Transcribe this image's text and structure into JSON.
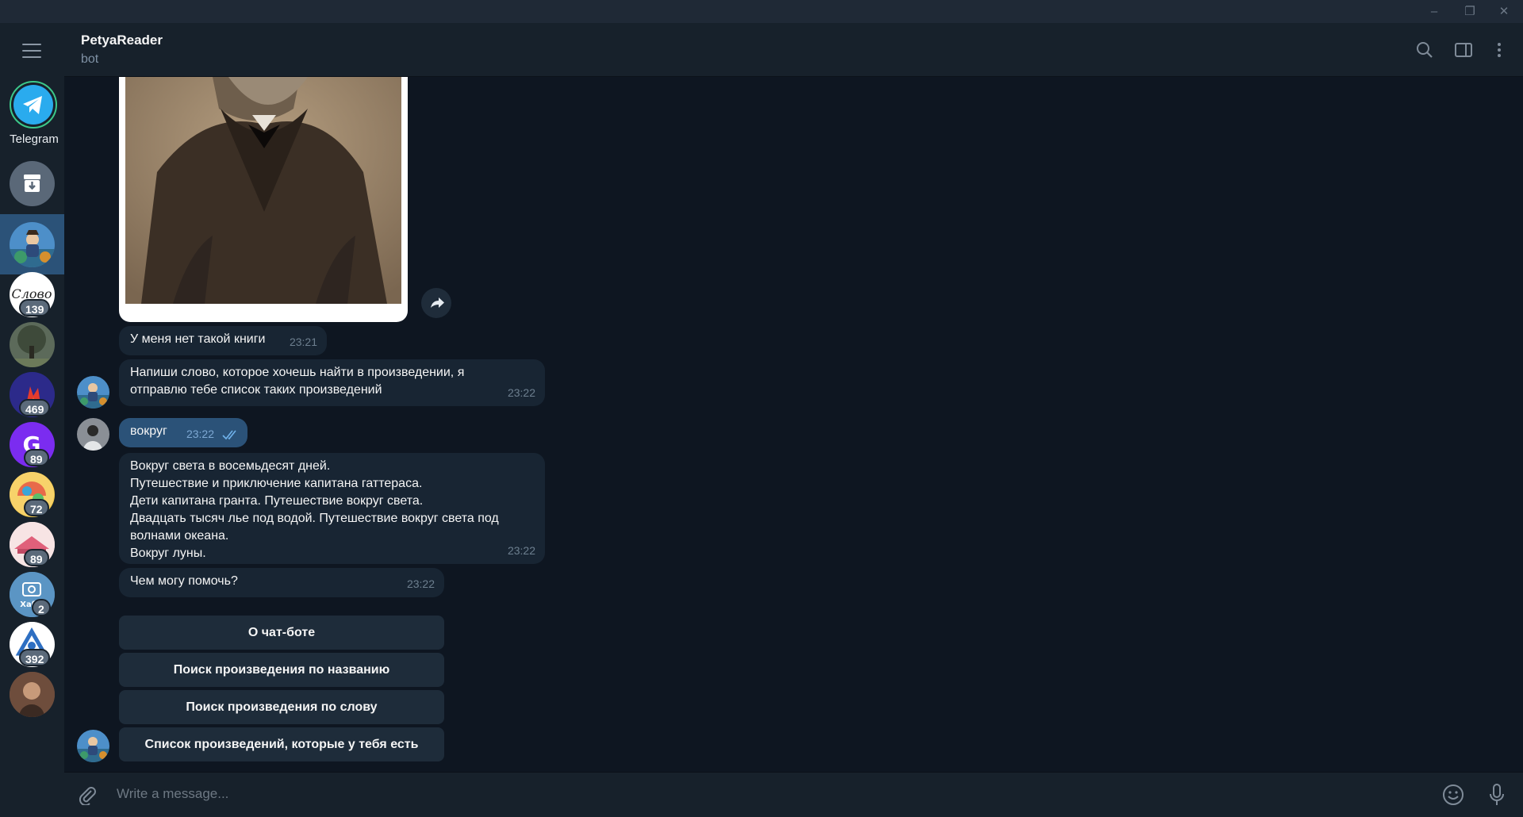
{
  "window": {
    "minimize_glyph": "–",
    "restore_glyph": "❐",
    "close_glyph": "✕"
  },
  "sidebar": {
    "folder_label": "Telegram",
    "chats": [
      {
        "badge": ""
      },
      {
        "badge": "139"
      },
      {
        "badge": ""
      },
      {
        "badge": "469"
      },
      {
        "badge": "89"
      },
      {
        "badge": "72"
      },
      {
        "badge": "89"
      },
      {
        "badge": "2"
      },
      {
        "badge": "392"
      },
      {
        "badge": ""
      }
    ]
  },
  "header": {
    "title": "PetyaReader",
    "subtitle": "bot"
  },
  "messages": [
    {
      "text": "У меня нет такой книги",
      "time": "23:21"
    },
    {
      "lines": [
        "Напиши слово, которое хочешь найти в произведении, я",
        "отправлю тебе список таких произведений"
      ],
      "time": "23:22"
    },
    {
      "text": "вокруг",
      "time": "23:22"
    },
    {
      "lines": [
        "Вокруг света в восемьдесят дней.",
        "Путешествие и приключение капитана гаттераса.",
        "Дети капитана гранта. Путешествие вокруг света.",
        "Двадцать тысяч лье под водой. Путешествие вокруг света под",
        "волнами океана.",
        "Вокруг луны."
      ],
      "time": "23:22"
    },
    {
      "text": "Чем могу помочь?",
      "time": "23:22"
    }
  ],
  "keyboard": [
    "О чат-боте",
    "Поиск произведения по названию",
    "Поиск произведения по слову",
    "Список произведений, которые у тебя есть"
  ],
  "input": {
    "placeholder": "Write a message..."
  },
  "colors": {
    "accent": "#2b5278",
    "background": "#0e1621",
    "panel": "#17212b",
    "bubble_in": "#182533"
  }
}
